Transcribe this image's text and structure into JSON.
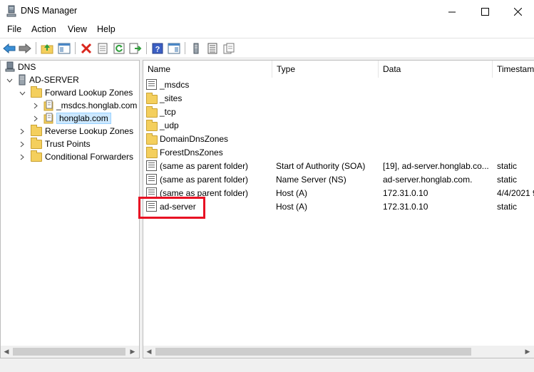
{
  "window": {
    "title": "DNS Manager"
  },
  "menu": [
    "File",
    "Action",
    "View",
    "Help"
  ],
  "tree": {
    "root": "DNS",
    "server": "AD-SERVER",
    "forward": "Forward Lookup Zones",
    "msdcs_zone": "_msdcs.honglab.com",
    "honglab_zone": "honglab.com",
    "reverse": "Reverse Lookup Zones",
    "trust": "Trust Points",
    "conditional": "Conditional Forwarders"
  },
  "columns": {
    "name": "Name",
    "type": "Type",
    "data": "Data",
    "timestamp": "Timestam"
  },
  "records": [
    {
      "name": "_msdcs",
      "type": "",
      "data": "",
      "timestamp": "",
      "icon": "record-icon"
    },
    {
      "name": "_sites",
      "type": "",
      "data": "",
      "timestamp": "",
      "icon": "folder-icon"
    },
    {
      "name": "_tcp",
      "type": "",
      "data": "",
      "timestamp": "",
      "icon": "folder-icon"
    },
    {
      "name": "_udp",
      "type": "",
      "data": "",
      "timestamp": "",
      "icon": "folder-icon"
    },
    {
      "name": "DomainDnsZones",
      "type": "",
      "data": "",
      "timestamp": "",
      "icon": "folder-icon"
    },
    {
      "name": "ForestDnsZones",
      "type": "",
      "data": "",
      "timestamp": "",
      "icon": "folder-icon"
    },
    {
      "name": "(same as parent folder)",
      "type": "Start of Authority (SOA)",
      "data": "[19], ad-server.honglab.co...",
      "timestamp": "static",
      "icon": "record-icon"
    },
    {
      "name": "(same as parent folder)",
      "type": "Name Server (NS)",
      "data": "ad-server.honglab.com.",
      "timestamp": "static",
      "icon": "record-icon"
    },
    {
      "name": "(same as parent folder)",
      "type": "Host (A)",
      "data": "172.31.0.10",
      "timestamp": "4/4/2021 9",
      "icon": "record-icon"
    },
    {
      "name": "ad-server",
      "type": "Host (A)",
      "data": "172.31.0.10",
      "timestamp": "static",
      "icon": "record-icon"
    }
  ],
  "colors": {
    "selection": "#cce8ff",
    "highlight": "#e81123"
  }
}
